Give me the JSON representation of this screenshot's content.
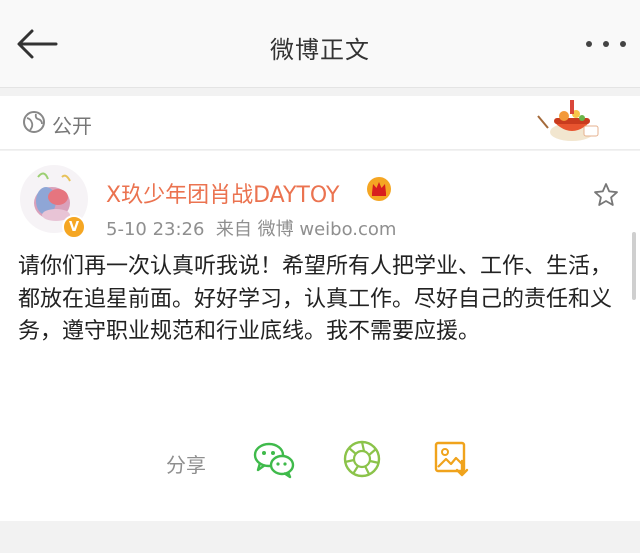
{
  "header": {
    "title": "微博正文"
  },
  "visibility": {
    "label": "公开"
  },
  "post": {
    "author": "X玖少年团肖战DAYTOY",
    "time": "5-10 23:26",
    "source": "来自 微博 weibo.com",
    "verified_badge": "V",
    "content": "请你们再一次认真听我说！希望所有人把学业、工作、生活，都放在追星前面。好好学习，认真工作。尽好自己的责任和义务，遵守职业规范和行业底线。我不需要应援。"
  },
  "share": {
    "label": "分享"
  },
  "colors": {
    "accent": "#eb7350",
    "wechat": "#3fba4b",
    "moments": "#8bc34a",
    "image": "#f0a31c"
  }
}
